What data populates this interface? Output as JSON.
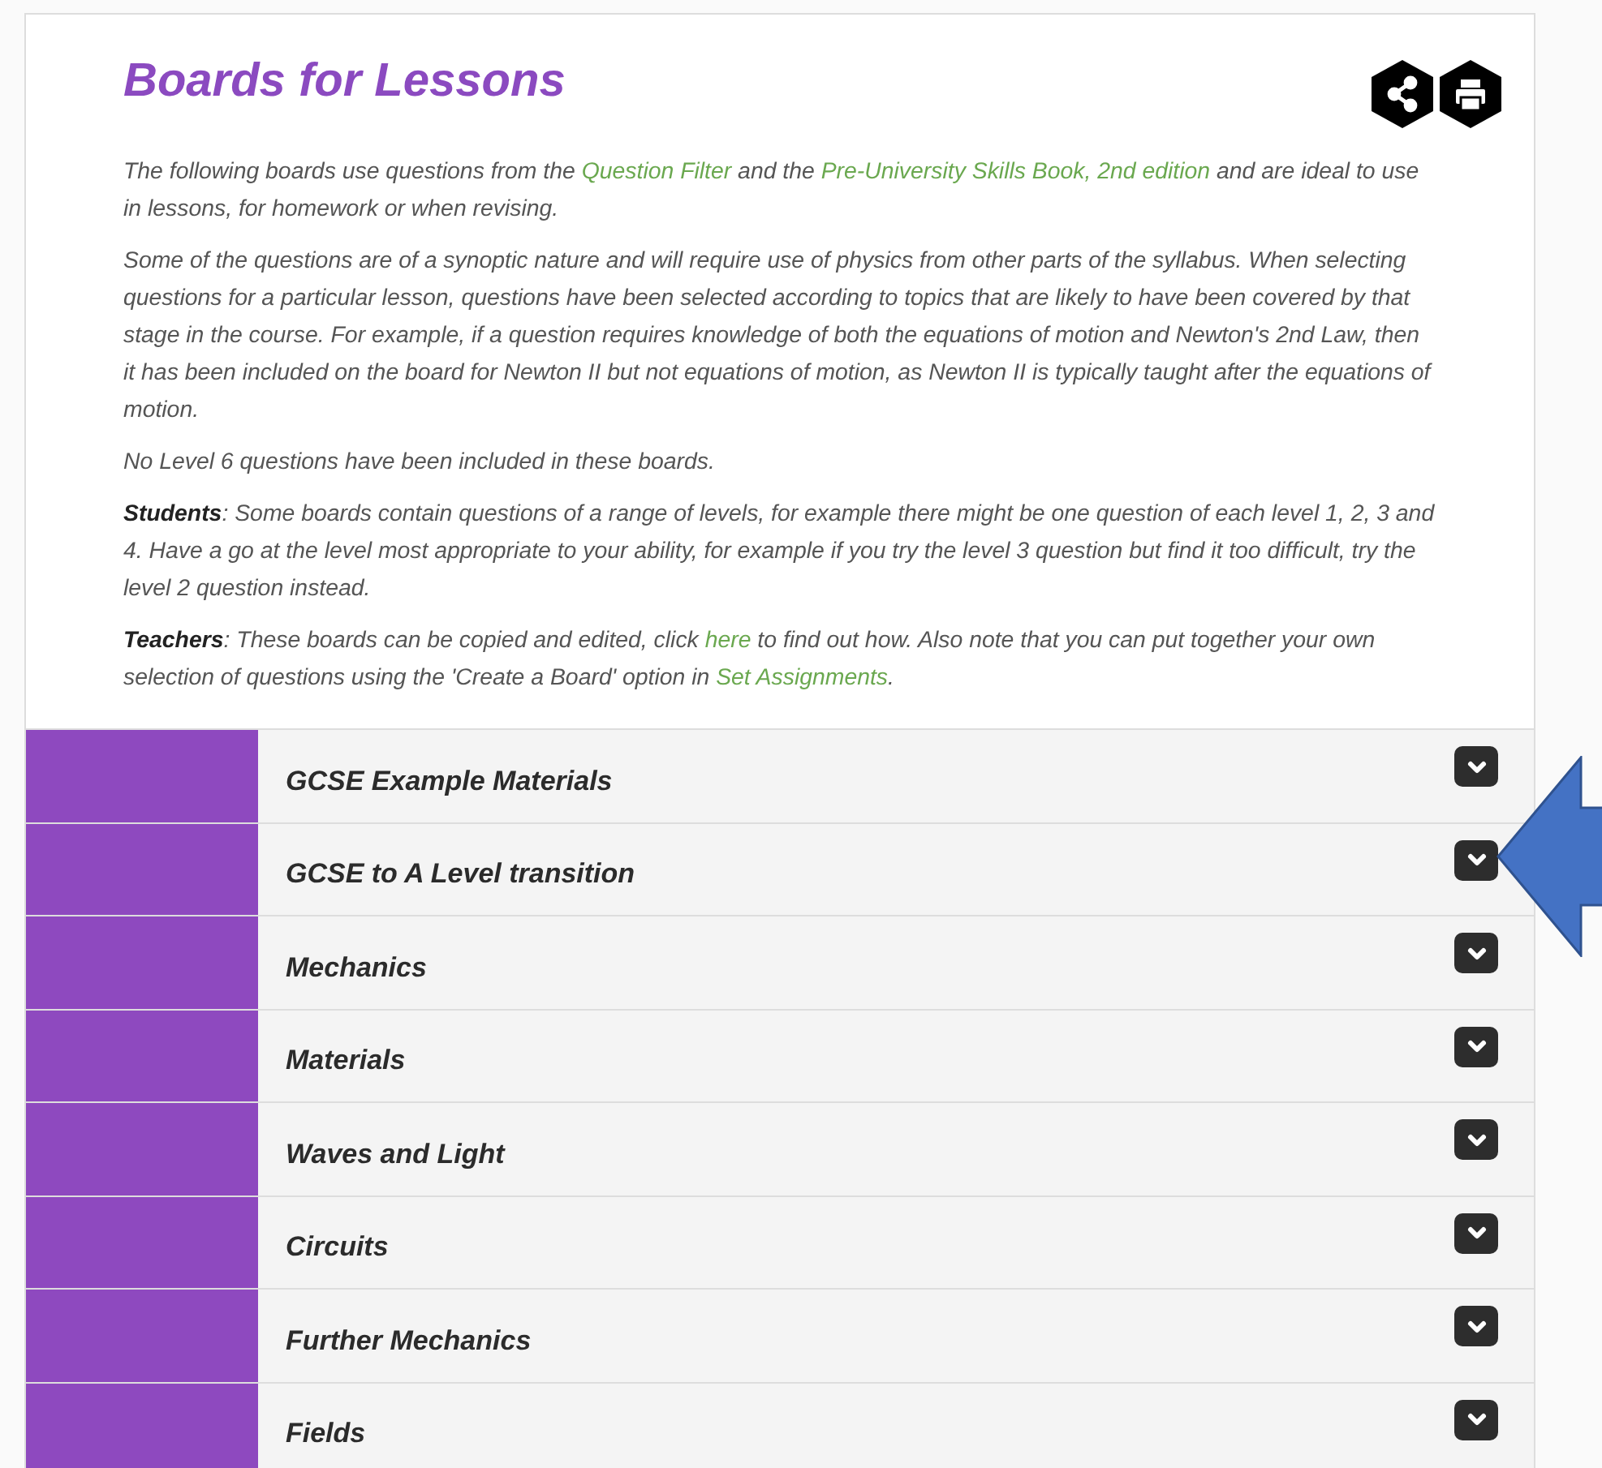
{
  "title": "Boards for Lessons",
  "paragraphs": [
    [
      {
        "kind": "text",
        "text": "The following boards use questions from the "
      },
      {
        "kind": "link",
        "text": "Question Filter"
      },
      {
        "kind": "text",
        "text": " and the "
      },
      {
        "kind": "link",
        "text": "Pre-University Skills Book, 2nd edition"
      },
      {
        "kind": "text",
        "text": " and are ideal to use in lessons, for homework or when revising."
      }
    ],
    [
      {
        "kind": "text",
        "text": "Some of the questions are of a synoptic nature and will require use of physics from other parts of the syllabus. When selecting questions for a particular lesson, questions have been selected according to topics that are likely to have been covered by that stage in the course. For example, if a question requires knowledge of both the equations of motion and Newton's 2nd Law, then it has been included on the board for Newton II but not equations of motion, as Newton II is typically taught after the equations of motion."
      }
    ],
    [
      {
        "kind": "text",
        "text": "No Level 6 questions have been included in these boards."
      }
    ],
    [
      {
        "kind": "text",
        "text": "**Students**: Some boards contain questions of a range of levels, for example there might be one question of each level 1, 2, 3 and 4. Have a go at the level most appropriate to your ability, for example if you try the level 3 question but find it too difficult, try the level 2 question instead."
      }
    ],
    [
      {
        "kind": "text",
        "text": "**Teachers**: These boards can be copied and edited, click "
      },
      {
        "kind": "link",
        "text": "here"
      },
      {
        "kind": "text",
        "text": " to find out how. Also note that you can put together your own selection of questions using the 'Create a Board' option in "
      },
      {
        "kind": "link",
        "text": "Set Assignments"
      },
      {
        "kind": "text",
        "text": "."
      }
    ]
  ],
  "boards": [
    {
      "label": "GCSE Example Materials",
      "expanded": false,
      "pointed_at": false
    },
    {
      "label": "GCSE to A Level transition",
      "expanded": false,
      "pointed_at": true
    },
    {
      "label": "Mechanics",
      "expanded": false,
      "pointed_at": false
    },
    {
      "label": "Materials",
      "expanded": false,
      "pointed_at": false
    },
    {
      "label": "Waves and Light",
      "expanded": false,
      "pointed_at": false
    },
    {
      "label": "Circuits",
      "expanded": false,
      "pointed_at": false
    },
    {
      "label": "Further Mechanics",
      "expanded": false,
      "pointed_at": false
    },
    {
      "label": "Fields",
      "expanded": false,
      "pointed_at": false
    }
  ]
}
